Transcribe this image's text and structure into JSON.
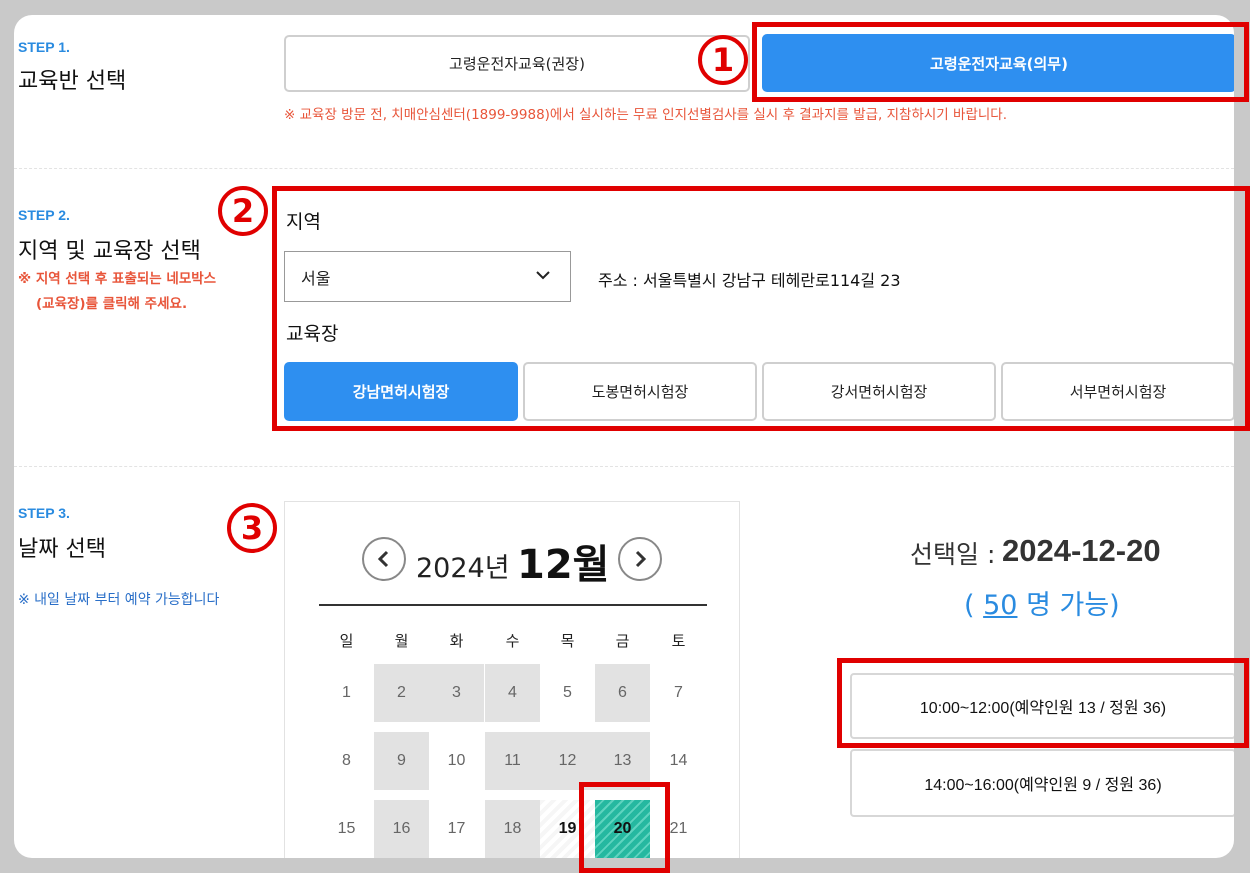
{
  "step1": {
    "label": "STEP 1.",
    "title": "교육반 선택",
    "options": [
      "고령운전자교육(권장)",
      "고령운전자교육(의무)"
    ],
    "notice": "※ 교육장 방문 전, 치매안심센터(1899-9988)에서 실시하는 무료 인지선별검사를 실시 후 결과지를 발급, 지참하시기 바랍니다."
  },
  "step2": {
    "label": "STEP 2.",
    "title": "지역 및 교육장 선택",
    "notice_line1": "※ 지역 선택 후 표출되는 네모박스",
    "notice_line2": "(교육장)를 클릭해 주세요.",
    "region_label": "지역",
    "region_value": "서울",
    "address": "주소 : 서울특별시 강남구 테헤란로114길 23",
    "center_label": "교육장",
    "centers": [
      "강남면허시험장",
      "도봉면허시험장",
      "강서면허시험장",
      "서부면허시험장"
    ]
  },
  "step3": {
    "label": "STEP 3.",
    "title": "날짜 선택",
    "notice": "※ 내일 날짜 부터 예약 가능합니다"
  },
  "calendar": {
    "year": "2024년",
    "month": "12월",
    "weekdays": [
      "일",
      "월",
      "화",
      "수",
      "목",
      "금",
      "토"
    ],
    "days": [
      "1",
      "2",
      "3",
      "4",
      "5",
      "6",
      "7",
      "8",
      "9",
      "10",
      "11",
      "12",
      "13",
      "14",
      "15",
      "16",
      "17",
      "18",
      "19",
      "20",
      "21"
    ],
    "available_days": [
      "2",
      "3",
      "4",
      "6",
      "9",
      "11",
      "12",
      "13",
      "16",
      "18"
    ],
    "today": "19",
    "selected": "20"
  },
  "selection": {
    "label": "선택일 :",
    "date": "2024-12-20",
    "open_prefix": "( ",
    "capacity": "50",
    "capacity_suffix": " 명 가능)"
  },
  "timeslots": [
    "10:00~12:00(예약인원 13 / 정원 36)",
    "14:00~16:00(예약인원 9 / 정원 36)"
  ],
  "annotations": [
    "1",
    "2",
    "3"
  ],
  "colors": {
    "accent_blue": "#2e8ff0",
    "annotation_red": "#e00000",
    "selected_teal": "#25b8a0",
    "notice_red": "#e8553a"
  }
}
